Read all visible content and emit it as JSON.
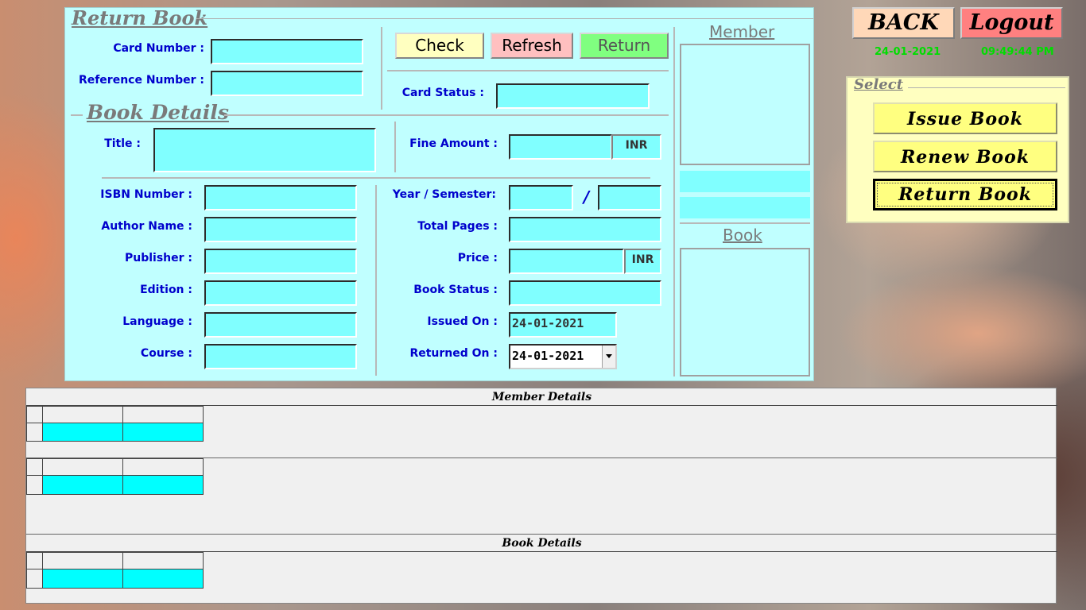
{
  "form": {
    "title": "Return Book",
    "book_details_title": "Book Details",
    "card_number": {
      "label": "Card Number  :",
      "value": ""
    },
    "reference_number": {
      "label": "Reference Number  :",
      "value": ""
    },
    "card_status": {
      "label": "Card Status  :",
      "value": ""
    },
    "title_field": {
      "label": "Title  :",
      "value": ""
    },
    "fine_amount": {
      "label": "Fine Amount  :",
      "value": "",
      "unit": "INR"
    },
    "isbn": {
      "label": "ISBN Number  :",
      "value": ""
    },
    "author": {
      "label": "Author Name  :",
      "value": ""
    },
    "publisher": {
      "label": "Publisher  :",
      "value": ""
    },
    "edition": {
      "label": "Edition  :",
      "value": ""
    },
    "language": {
      "label": "Language  :",
      "value": ""
    },
    "course": {
      "label": "Course  :",
      "value": ""
    },
    "year_semester": {
      "label": "Year / Semester:",
      "year": "",
      "separator": "/",
      "semester": ""
    },
    "total_pages": {
      "label": "Total Pages  :",
      "value": ""
    },
    "price": {
      "label": "Price  :",
      "value": "",
      "unit": "INR"
    },
    "book_status": {
      "label": "Book Status  :",
      "value": ""
    },
    "issued_on": {
      "label": "Issued On  :",
      "value": "24-01-2021"
    },
    "returned_on": {
      "label": "Returned On  :",
      "value": "24-01-2021"
    }
  },
  "buttons": {
    "check": "Check",
    "refresh": "Refresh",
    "return": "Return"
  },
  "side": {
    "member_title": "Member",
    "book_title": "Book"
  },
  "header": {
    "back": "BACK",
    "logout": "Logout",
    "date": "24-01-2021",
    "time": "09:49:44 PM"
  },
  "select": {
    "title": "Select",
    "items": [
      "Issue  Book",
      "Renew  Book",
      "Return  Book"
    ],
    "active": "Return  Book"
  },
  "grids": {
    "member_caption": "Member  Details",
    "book_caption": "Book  Details"
  },
  "colors": {
    "panel": "#c0ffff",
    "field": "#80ffff",
    "label": "#0000cc",
    "accent_green": "#00dd00"
  }
}
